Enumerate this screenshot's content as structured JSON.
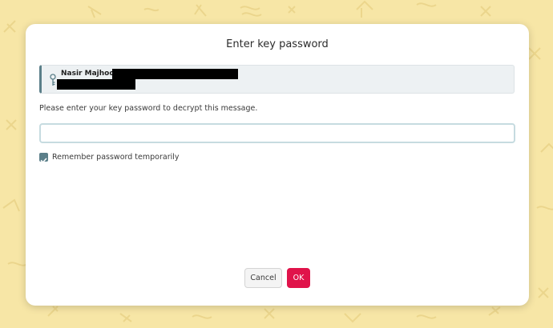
{
  "dialog": {
    "title": "Enter key password",
    "key_owner_name": "Nasir Majhool",
    "prompt": "Please enter your key password to decrypt this message.",
    "password_input": {
      "value": "",
      "placeholder": ""
    },
    "remember_checkbox": {
      "checked": true,
      "label": "Remember password temporarily"
    },
    "cancel_label": "Cancel",
    "ok_label": "OK"
  },
  "colors": {
    "background": "#f7e6a6",
    "accent": "#5b7f89",
    "primary_button": "#e0134a"
  },
  "icons": {
    "key": "key-icon",
    "check": "checkmark-icon"
  }
}
